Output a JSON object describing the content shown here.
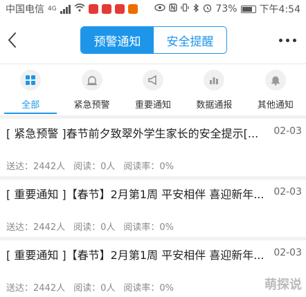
{
  "status_bar": {
    "carrier": "中国电信",
    "network": "4G",
    "battery": "73%",
    "time": "下午4:54"
  },
  "header": {
    "tabs": [
      {
        "label": "预警通知",
        "active": true
      },
      {
        "label": "安全提醒",
        "active": false
      }
    ]
  },
  "categories": [
    {
      "label": "全部",
      "icon": "grid-icon",
      "active": true
    },
    {
      "label": "紧急预警",
      "icon": "siren-icon",
      "active": false
    },
    {
      "label": "重要通知",
      "icon": "megaphone-icon",
      "active": false
    },
    {
      "label": "数据通报",
      "icon": "bar-chart-icon",
      "active": false
    },
    {
      "label": "其他通知",
      "icon": "bell-icon",
      "active": false
    }
  ],
  "items": [
    {
      "title": "[ 紧急预警 ]春节前夕致翠外学生家长的安全提示[...",
      "date": "02-03",
      "sent": "送达：2442人",
      "read": "阅读：0人",
      "rate": "阅读率：0%"
    },
    {
      "title": "[ 重要通知 ]【春节】2月第1周 平安相伴 喜迎新年...",
      "date": "02-03",
      "sent": "送达：2442人",
      "read": "阅读：0人",
      "rate": "阅读率：0%"
    },
    {
      "title": "[ 重要通知 ]【春节】2月第1周 平安相伴 喜迎新年...",
      "date": "02-03",
      "sent": "送达：2442人",
      "read": "阅读：0人",
      "rate": "阅读率：0%"
    }
  ],
  "watermark": "萌探说",
  "colors": {
    "accent": "#1d96ea"
  }
}
